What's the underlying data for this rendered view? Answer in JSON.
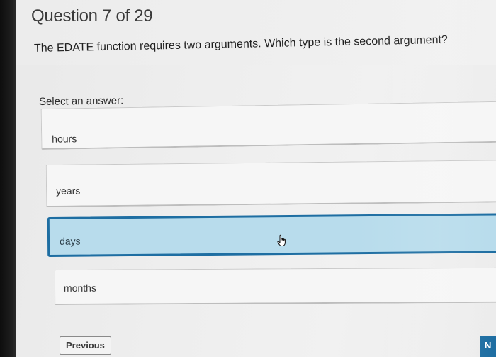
{
  "header": {
    "question_count": "Question 7 of 29"
  },
  "question": {
    "prompt": "The EDATE function requires two arguments. Which type is the second argument?",
    "select_label": "Select an answer:"
  },
  "options": [
    {
      "label": "hours",
      "selected": false
    },
    {
      "label": "years",
      "selected": false
    },
    {
      "label": "days",
      "selected": true
    },
    {
      "label": "months",
      "selected": false
    }
  ],
  "navigation": {
    "previous_label": "Previous",
    "next_label": "N"
  },
  "colors": {
    "accent": "#1e6ea2",
    "selected_fill": "#b8dcec"
  },
  "icons": {
    "pointer": "hand-pointer-icon"
  }
}
